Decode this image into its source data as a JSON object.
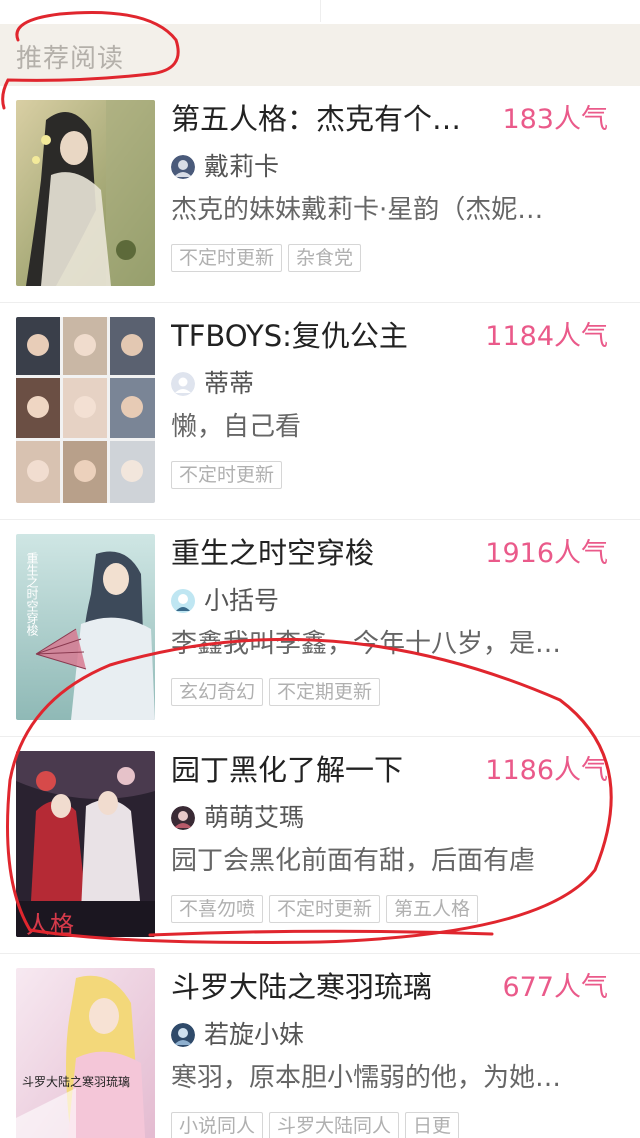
{
  "section": {
    "title": "推荐阅读"
  },
  "books": [
    {
      "title": "第五人格：杰克有个…",
      "popularity": "183人气",
      "author": "戴莉卡",
      "summary": "杰克的妹妹戴莉卡·星韵（杰妮…",
      "tags": [
        "不定时更新",
        "杂食党"
      ]
    },
    {
      "title": "TFBOYS:复仇公主",
      "popularity": "1184人气",
      "author": "蒂蒂",
      "summary": "懒，自己看",
      "tags": [
        "不定时更新"
      ]
    },
    {
      "title": "重生之时空穿梭",
      "popularity": "1916人气",
      "author": "小括号",
      "summary": "李鑫我叫李鑫，今年十八岁，是…",
      "tags": [
        "玄幻奇幻",
        "不定期更新"
      ],
      "cover_text": "重生之时空穿梭"
    },
    {
      "title": "园丁黑化了解一下",
      "popularity": "1186人气",
      "author": "萌萌艾瑪",
      "summary": "园丁会黑化前面有甜，后面有虐",
      "tags": [
        "不喜勿喷",
        "不定时更新",
        "第五人格"
      ],
      "cover_text": "人格"
    },
    {
      "title": "斗罗大陆之寒羽琉璃",
      "popularity": "677人气",
      "author": "若旋小妹",
      "summary": "寒羽，原本胆小懦弱的他，为她…",
      "tags": [
        "小说同人",
        "斗罗大陆同人",
        "日更"
      ],
      "cover_text": "斗罗大陆之寒羽琉璃"
    }
  ],
  "colors": {
    "popularity": "#ea5a8a",
    "header_bg": "#f3f0ea",
    "annotation": "#e0262e"
  }
}
